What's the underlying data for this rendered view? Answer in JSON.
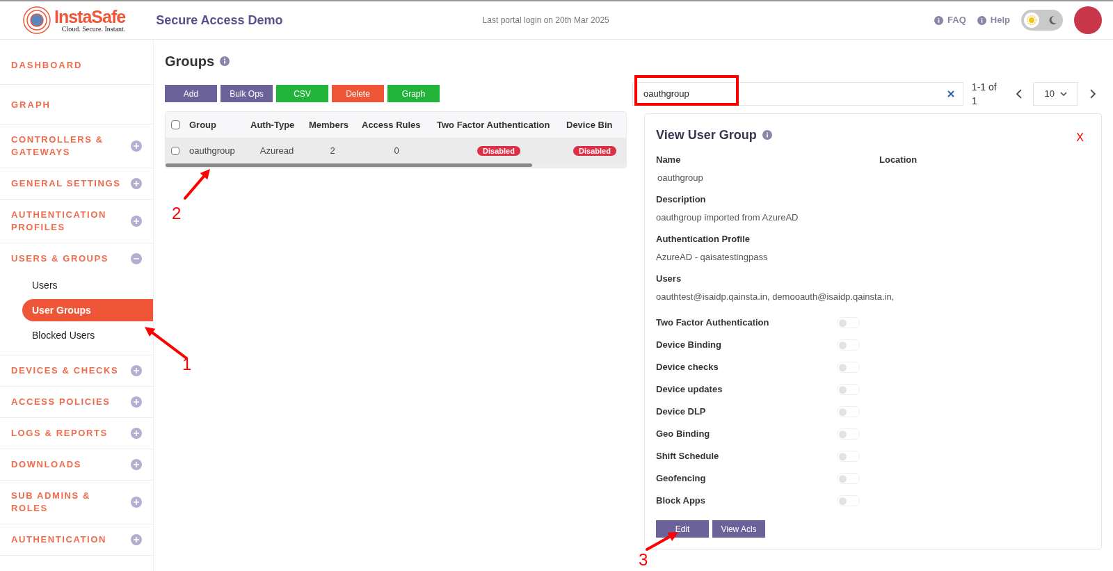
{
  "header": {
    "logo": {
      "name": "InstaSafe",
      "tagline": "Cloud. Secure. Instant."
    },
    "title": "Secure Access Demo",
    "last_login": "Last portal login on 20th Mar 2025",
    "links": [
      "FAQ",
      "Help"
    ],
    "theme_dark": false
  },
  "sidebar": {
    "items": [
      {
        "label": "DASHBOARD",
        "kind": "link"
      },
      {
        "label": "GRAPH",
        "kind": "link"
      },
      {
        "label": "CONTROLLERS & GATEWAYS",
        "kind": "section",
        "expanded": false
      },
      {
        "label": "GENERAL SETTINGS",
        "kind": "section",
        "expanded": false
      },
      {
        "label": "AUTHENTICATION PROFILES",
        "kind": "section",
        "expanded": false
      },
      {
        "label": "USERS & GROUPS",
        "kind": "section",
        "expanded": true,
        "children": [
          {
            "label": "Users",
            "selected": false
          },
          {
            "label": "User Groups",
            "selected": true
          },
          {
            "label": "Blocked Users",
            "selected": false
          }
        ]
      },
      {
        "label": "DEVICES & CHECKS",
        "kind": "section",
        "expanded": false
      },
      {
        "label": "ACCESS POLICIES",
        "kind": "section",
        "expanded": false
      },
      {
        "label": "LOGS & REPORTS",
        "kind": "section",
        "expanded": false
      },
      {
        "label": "DOWNLOADS",
        "kind": "section",
        "expanded": false
      },
      {
        "label": "SUB ADMINS & ROLES",
        "kind": "section",
        "expanded": false
      },
      {
        "label": "AUTHENTICATION",
        "kind": "section",
        "expanded": false
      }
    ]
  },
  "page": {
    "title": "Groups",
    "buttons": [
      {
        "label": "Add",
        "color": "#6a6299"
      },
      {
        "label": "Bulk Ops",
        "color": "#6a6299"
      },
      {
        "label": "CSV",
        "color": "#22b33a"
      },
      {
        "label": "Delete",
        "color": "#ef5637"
      },
      {
        "label": "Graph",
        "color": "#22b33a"
      }
    ],
    "table": {
      "header_checked": false,
      "columns": [
        "Group",
        "Auth-Type",
        "Members",
        "Access Rules",
        "Two Factor Authentication",
        "Device Bin"
      ],
      "rows": [
        {
          "checked": false,
          "cells": [
            "oauthgroup",
            "Azuread",
            "2",
            "0",
            "Disabled",
            "Disabled"
          ]
        }
      ]
    },
    "search": {
      "value": "oauthgroup"
    },
    "pagination": {
      "range": "1-1 of 1",
      "page_size": "10"
    }
  },
  "detail": {
    "title": "View User Group",
    "close": "X",
    "fields": [
      {
        "label": "Name",
        "value": "oauthgroup"
      },
      {
        "label": "Location"
      },
      {
        "label": "Description",
        "value": "oauthgroup imported from AzureAD"
      },
      {
        "label": "Authentication Profile",
        "value": "AzureAD - qaisatestingpass"
      },
      {
        "label": "Users",
        "value": "oauthtest@isaidp.qainsta.in, demooauth@isaidp.qainsta.in,"
      }
    ],
    "toggles": [
      {
        "label": "Two Factor Authentication",
        "on": false
      },
      {
        "label": "Device Binding",
        "on": false
      },
      {
        "label": "Device checks",
        "on": false
      },
      {
        "label": "Device updates",
        "on": false
      },
      {
        "label": "Device DLP",
        "on": false
      },
      {
        "label": "Geo Binding",
        "on": false
      },
      {
        "label": "Shift Schedule",
        "on": false
      },
      {
        "label": "Geofencing",
        "on": false
      },
      {
        "label": "Block Apps",
        "on": false
      }
    ],
    "buttons": [
      "Edit",
      "View Acls"
    ]
  },
  "annotations": [
    {
      "label": "1"
    },
    {
      "label": "2"
    },
    {
      "label": "3"
    }
  ]
}
